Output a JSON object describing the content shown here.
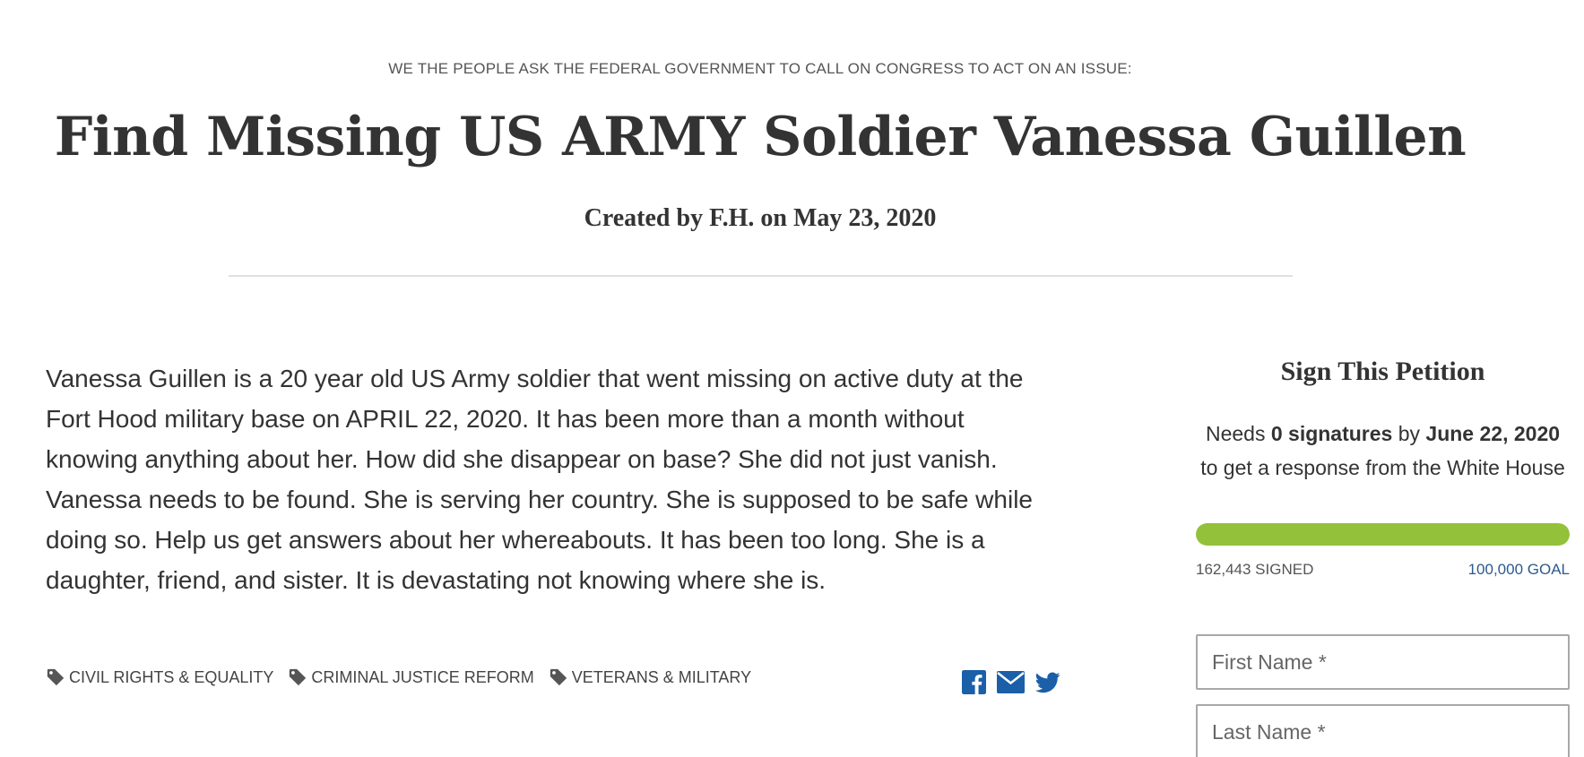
{
  "header": {
    "kicker": "WE THE PEOPLE ASK THE FEDERAL GOVERNMENT TO CALL ON CONGRESS TO ACT ON AN ISSUE:",
    "title": "Find Missing US ARMY Soldier Vanessa Guillen",
    "byline": "Created by F.H. on May 23, 2020"
  },
  "petition": {
    "body": "Vanessa Guillen is a 20 year old US Army soldier that went missing on active duty at the Fort Hood military base on APRIL 22, 2020. It has been more than a month without knowing anything about her. How did she disappear on base? She did not just vanish. Vanessa needs to be found. She is serving her country. She is supposed to be safe while doing so. Help us get answers about her whereabouts. It has been too long. She is a daughter, friend, and sister. It is devastating not knowing where she is."
  },
  "tags": [
    {
      "label": "CIVIL RIGHTS & EQUALITY",
      "icon": "tag-icon"
    },
    {
      "label": "CRIMINAL JUSTICE REFORM",
      "icon": "tag-icon"
    },
    {
      "label": "VETERANS & MILITARY",
      "icon": "tag-icon"
    }
  ],
  "share": [
    {
      "name": "facebook",
      "icon": "facebook-icon"
    },
    {
      "name": "email",
      "icon": "email-icon"
    },
    {
      "name": "twitter",
      "icon": "twitter-icon"
    }
  ],
  "sign": {
    "title": "Sign This Petition",
    "needs_prefix": "Needs",
    "needs_count": "0 signatures",
    "needs_by": "by",
    "deadline": "June 22, 2020",
    "needs_suffix": "to get a response from the White House",
    "progress_fraction": 1.0,
    "signed_label": "162,443 SIGNED",
    "goal_label": "100,000 GOAL",
    "first_name_placeholder": "First Name *",
    "last_name_placeholder": "Last Name *"
  },
  "colors": {
    "progress": "#93c13a",
    "link_blue": "#2c5a8c",
    "share_blue": "#1a5fa8"
  }
}
